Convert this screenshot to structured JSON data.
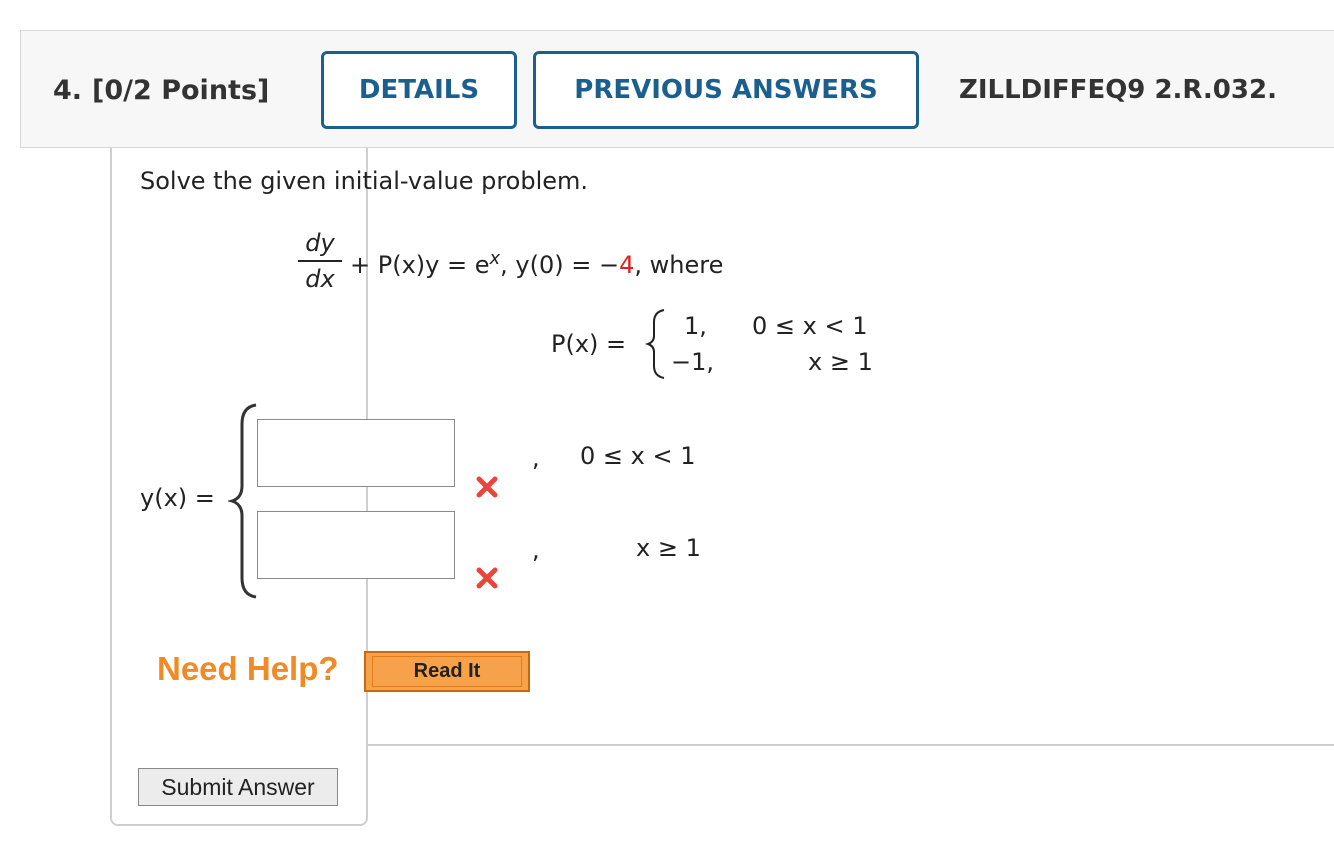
{
  "header": {
    "question_number": "4.",
    "points": "[0/2 Points]",
    "details_label": "DETAILS",
    "previous_answers_label": "PREVIOUS ANSWERS",
    "question_id": "ZILLDIFFEQ9 2.R.032."
  },
  "problem": {
    "prompt": "Solve the given initial-value problem.",
    "frac_num": "dy",
    "frac_den": "dx",
    "eq_part1": "+ P(x)y = e",
    "eq_exp": "x",
    "eq_part2": ",   y(0) = −",
    "initial_value": "4",
    "eq_part3": ", where",
    "px_label": "P(x) =",
    "px_case1_value": "1,",
    "px_case1_cond": "0 ≤ x < 1",
    "px_case2_value": "−1,",
    "px_case2_cond": "x ≥ 1"
  },
  "answer": {
    "label": "y(x) =",
    "input1_value": "",
    "input2_value": "",
    "comma": ",",
    "cond1": "0 ≤ x < 1",
    "cond2": "x ≥ 1",
    "status1": "incorrect",
    "status2": "incorrect"
  },
  "help": {
    "need_help_label": "Need Help?",
    "read_it_label": "Read It"
  },
  "footer": {
    "submit_label": "Submit Answer"
  },
  "colors": {
    "accent_blue": "#1b5f8f",
    "error_red": "#e02020",
    "help_orange": "#f08a24",
    "read_it_bg": "#f7a24a"
  },
  "icons": {
    "incorrect": "x-mark-icon"
  }
}
